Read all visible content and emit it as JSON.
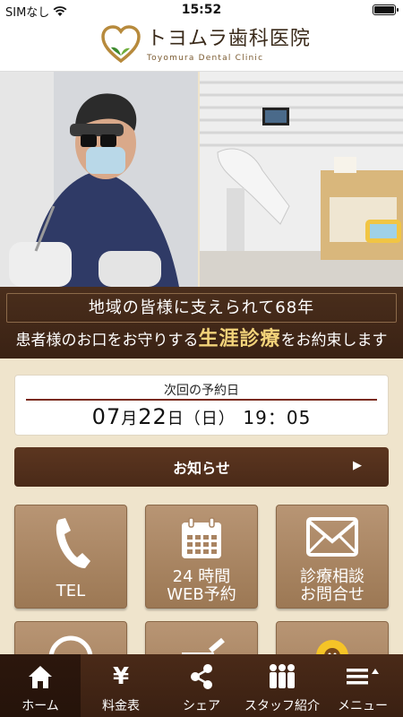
{
  "status_bar": {
    "carrier": "SIMなし",
    "time": "15:52"
  },
  "header": {
    "clinic_name_jp": "トヨムラ歯科医院",
    "clinic_name_en": "Toyomura Dental Clinic"
  },
  "hero": {
    "left_photo": "dentist-photo",
    "right_photo": "treatment-room-photo"
  },
  "slogan": {
    "line1": "地域の皆様に支えられて68年",
    "line2_before": "患者様のお口をお守りする",
    "line2_highlight": "生涯診療",
    "line2_after": "をお約束します"
  },
  "appointment": {
    "label": "次回の予約日",
    "month": "07",
    "month_unit": "月",
    "day": "22",
    "day_unit": "日",
    "weekday": "（日）",
    "time": "19：05"
  },
  "news": {
    "label": "お知らせ"
  },
  "tiles": [
    {
      "icon": "phone-icon",
      "label": "TEL"
    },
    {
      "icon": "calendar-icon",
      "label_line1": "24 時間",
      "label_line2": "WEB予約"
    },
    {
      "icon": "mail-icon",
      "label_line1": "診療相談",
      "label_line2": "お問合せ"
    }
  ],
  "tab_bar": {
    "items": [
      {
        "icon": "home-icon",
        "label": "ホーム",
        "active": true
      },
      {
        "icon": "yen-icon",
        "icon_glyph": "¥",
        "label": "料金表"
      },
      {
        "icon": "share-icon",
        "label": "シェア"
      },
      {
        "icon": "staff-icon",
        "label": "スタッフ紹介"
      },
      {
        "icon": "menu-icon",
        "label": "メニュー"
      }
    ]
  },
  "colors": {
    "brown_dark": "#3a2214",
    "tile_brown": "#a98462",
    "highlight_gold": "#f2d37a",
    "background_beige": "#efe4cc",
    "appointment_rule": "#7a2a1a"
  }
}
